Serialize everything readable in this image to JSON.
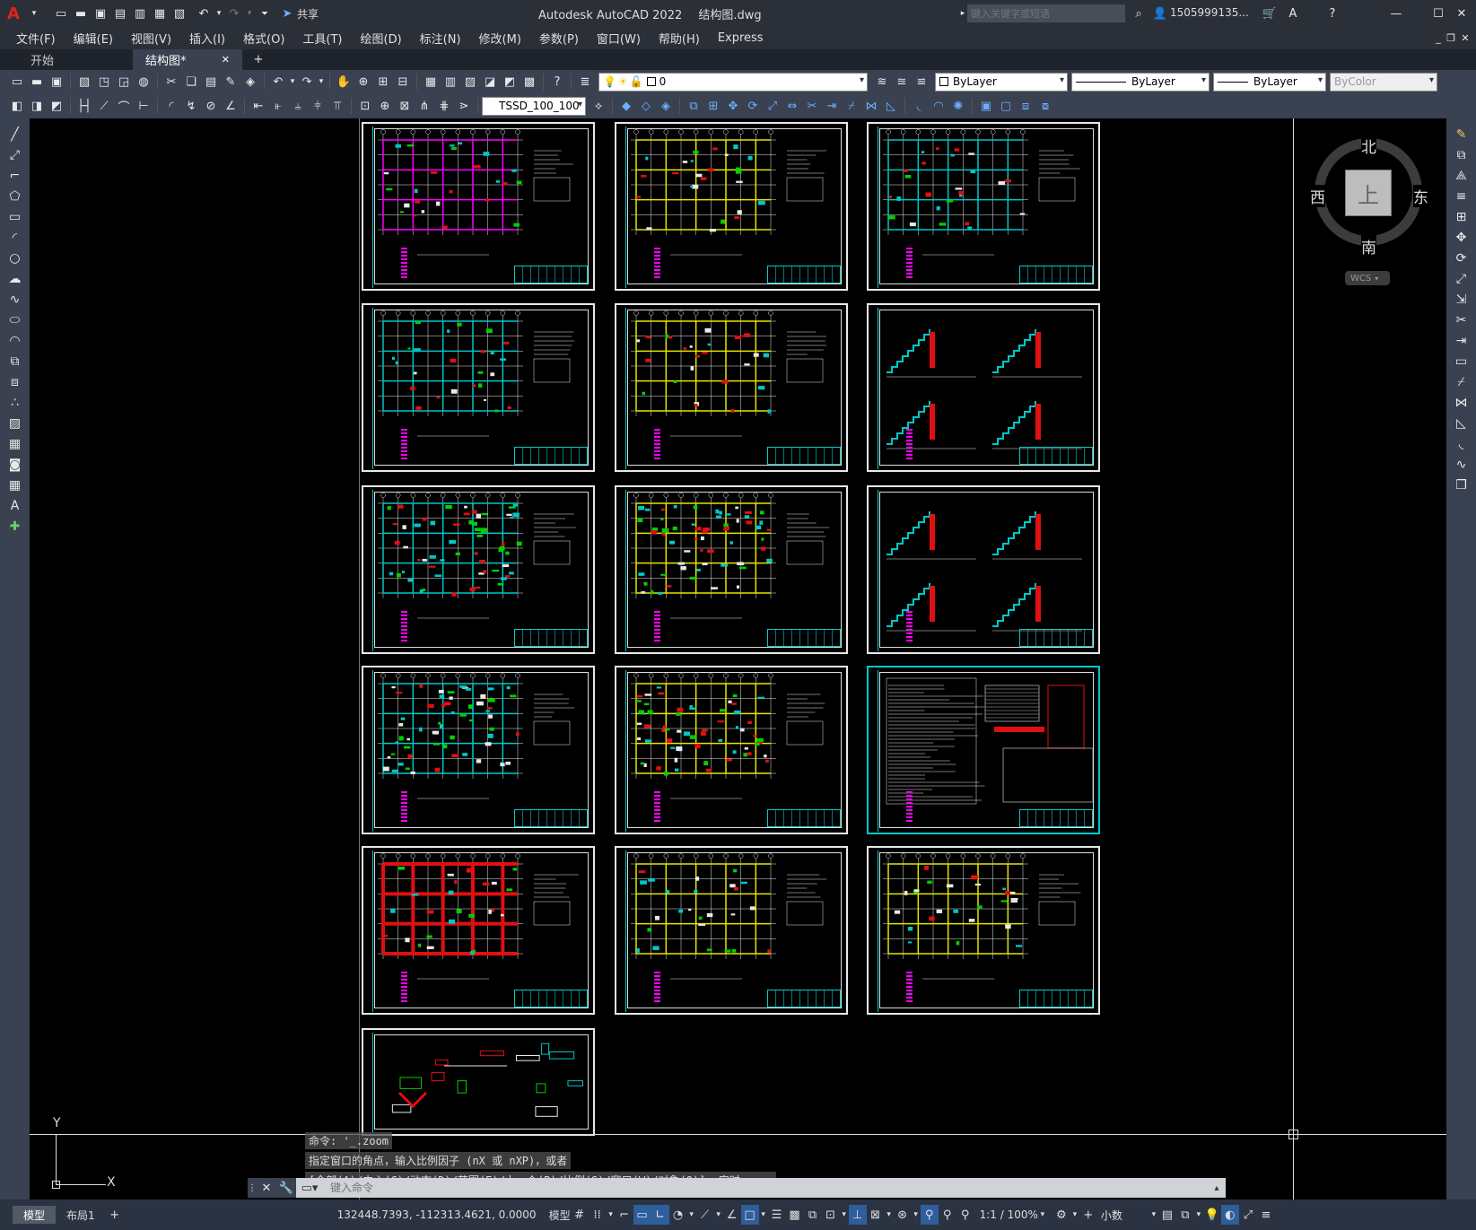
{
  "titlebar": {
    "app_title": "Autodesk AutoCAD 2022",
    "file_name": "结构图.dwg",
    "share_label": "共享",
    "search_placeholder": "键入关键字或短语",
    "user": "1505999135..."
  },
  "menu": [
    "文件(F)",
    "编辑(E)",
    "视图(V)",
    "插入(I)",
    "格式(O)",
    "工具(T)",
    "绘图(D)",
    "标注(N)",
    "修改(M)",
    "参数(P)",
    "窗口(W)",
    "帮助(H)",
    "Express"
  ],
  "tabs": {
    "start": "开始",
    "active": "结构图*"
  },
  "properties": {
    "layer": "0",
    "color": "ByLayer",
    "linetype": "ByLayer",
    "lineweight": "ByLayer",
    "plotstyle": "ByColor",
    "dimstyle": "TSSD_100_100"
  },
  "viewcube": {
    "north": "北",
    "south": "南",
    "east": "东",
    "west": "西",
    "top": "上",
    "wcs": "WCS"
  },
  "ucs": {
    "x": "X",
    "y": "Y"
  },
  "command": {
    "history": [
      "命令: '_.zoom",
      "指定窗口的角点，输入比例因子 (nX 或 nXP)，或者",
      "[全部(A)/中心(C)/动态(D)/范围(E)/上一个(P)/比例(S)/窗口(W)/对象(O)] <实时>: _e"
    ],
    "placeholder": "键入命令"
  },
  "status": {
    "model_tab": "模型",
    "layout_tab": "布局1",
    "coords": "132448.7393, -112313.4621, 0.0000",
    "space": "模型",
    "scale": "1:1 / 100%",
    "units": "小数"
  },
  "colors": {
    "cyan": "#00c8c8",
    "yellow": "#e6e600",
    "red": "#e01010",
    "magenta": "#ff00ff",
    "green": "#00d000",
    "white": "#e8e8e8",
    "blue": "#2e5e9c"
  }
}
